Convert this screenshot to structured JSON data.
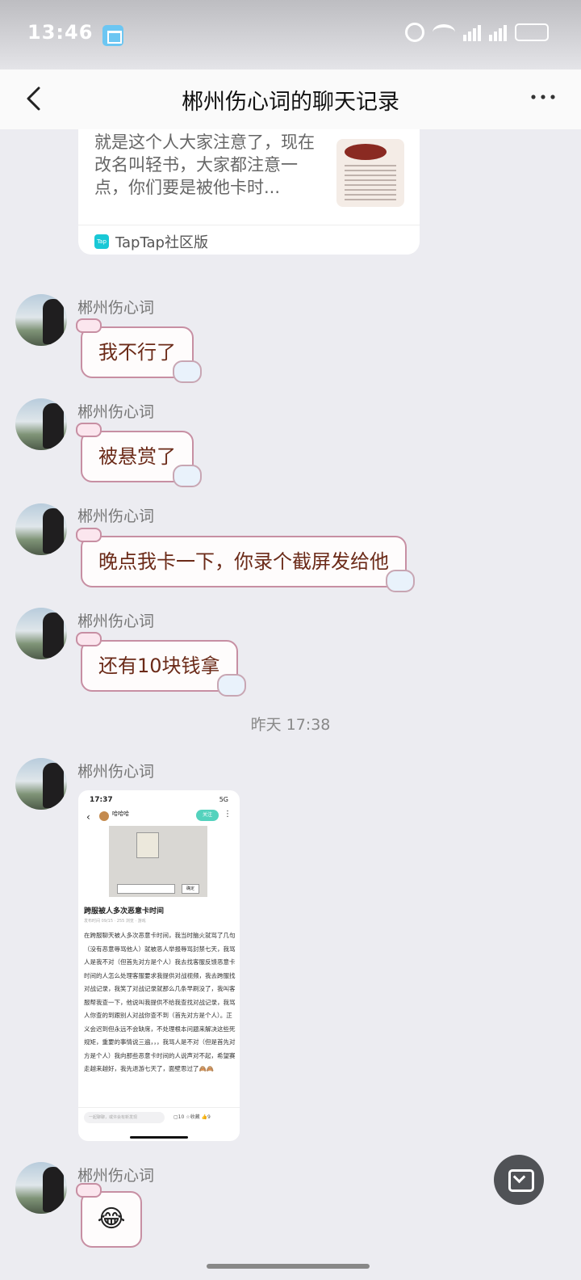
{
  "status_bar": {
    "time": "13:46"
  },
  "header": {
    "title": "郴州伤心词的聊天记录"
  },
  "shared_card": {
    "text": "就是这个人大家注意了，现在改名叫轻书，大家都注意一点，你们要是被他卡时...",
    "source_icon": "Tap",
    "source": "TapTap社区版"
  },
  "messages": [
    {
      "sender": "郴州伤心词",
      "text": "我不行了"
    },
    {
      "sender": "郴州伤心词",
      "text": "被悬赏了"
    },
    {
      "sender": "郴州伤心词",
      "text": "晚点我卡一下，你录个截屏发给他"
    },
    {
      "sender": "郴州伤心词",
      "text": "还有10块钱拿"
    },
    {
      "sender": "郴州伤心词"
    },
    {
      "sender": "郴州伤心词",
      "emoji": "😂"
    }
  ],
  "timestamp": "昨天 17:38",
  "screenshot": {
    "time": "17:37",
    "network": "5G",
    "user": "哈哈哈",
    "follow": "关注",
    "input_button": "确定",
    "title": "跨服被人多次恶意卡时间",
    "meta": "发布时间 09/15 · 255 浏览 · 游戏",
    "body": "在跨服聊天被人多次恶意卡时间，我当时脑火就骂了几句（没有恶意辱骂他人）就被恶人举报辱骂封禁七天，我骂人是我不对（但首先对方是个人）我去找客服反馈恶意卡时间的人怎么处理客服要求我提供对战视频，我去跨服找对战记录，我笑了对战记录就那么几条早刷没了，我叫客服帮我查一下，他说叫我提供不给我查找对战记录，我骂人你查的到跟别人对战你查不到（首先对方是个人）。正义会迟到但永远不会缺席，不处理根本问题来解决这些死规矩，重要的事情说三遍，，，我骂人是不对（但是首先对方是个人）我向那些恶意卡时间的人说声对不起，希望赛走越来越好，我先退游七天了，面壁思过了🙈🙈",
    "reply_placeholder": "一起聊聊，或许会有新发现",
    "comments": "10",
    "favorites": "收藏",
    "likes": "9"
  },
  "colors": {
    "accent": "#c78fa3",
    "bubble_text": "#6b2a18",
    "background": "#ececf1"
  }
}
